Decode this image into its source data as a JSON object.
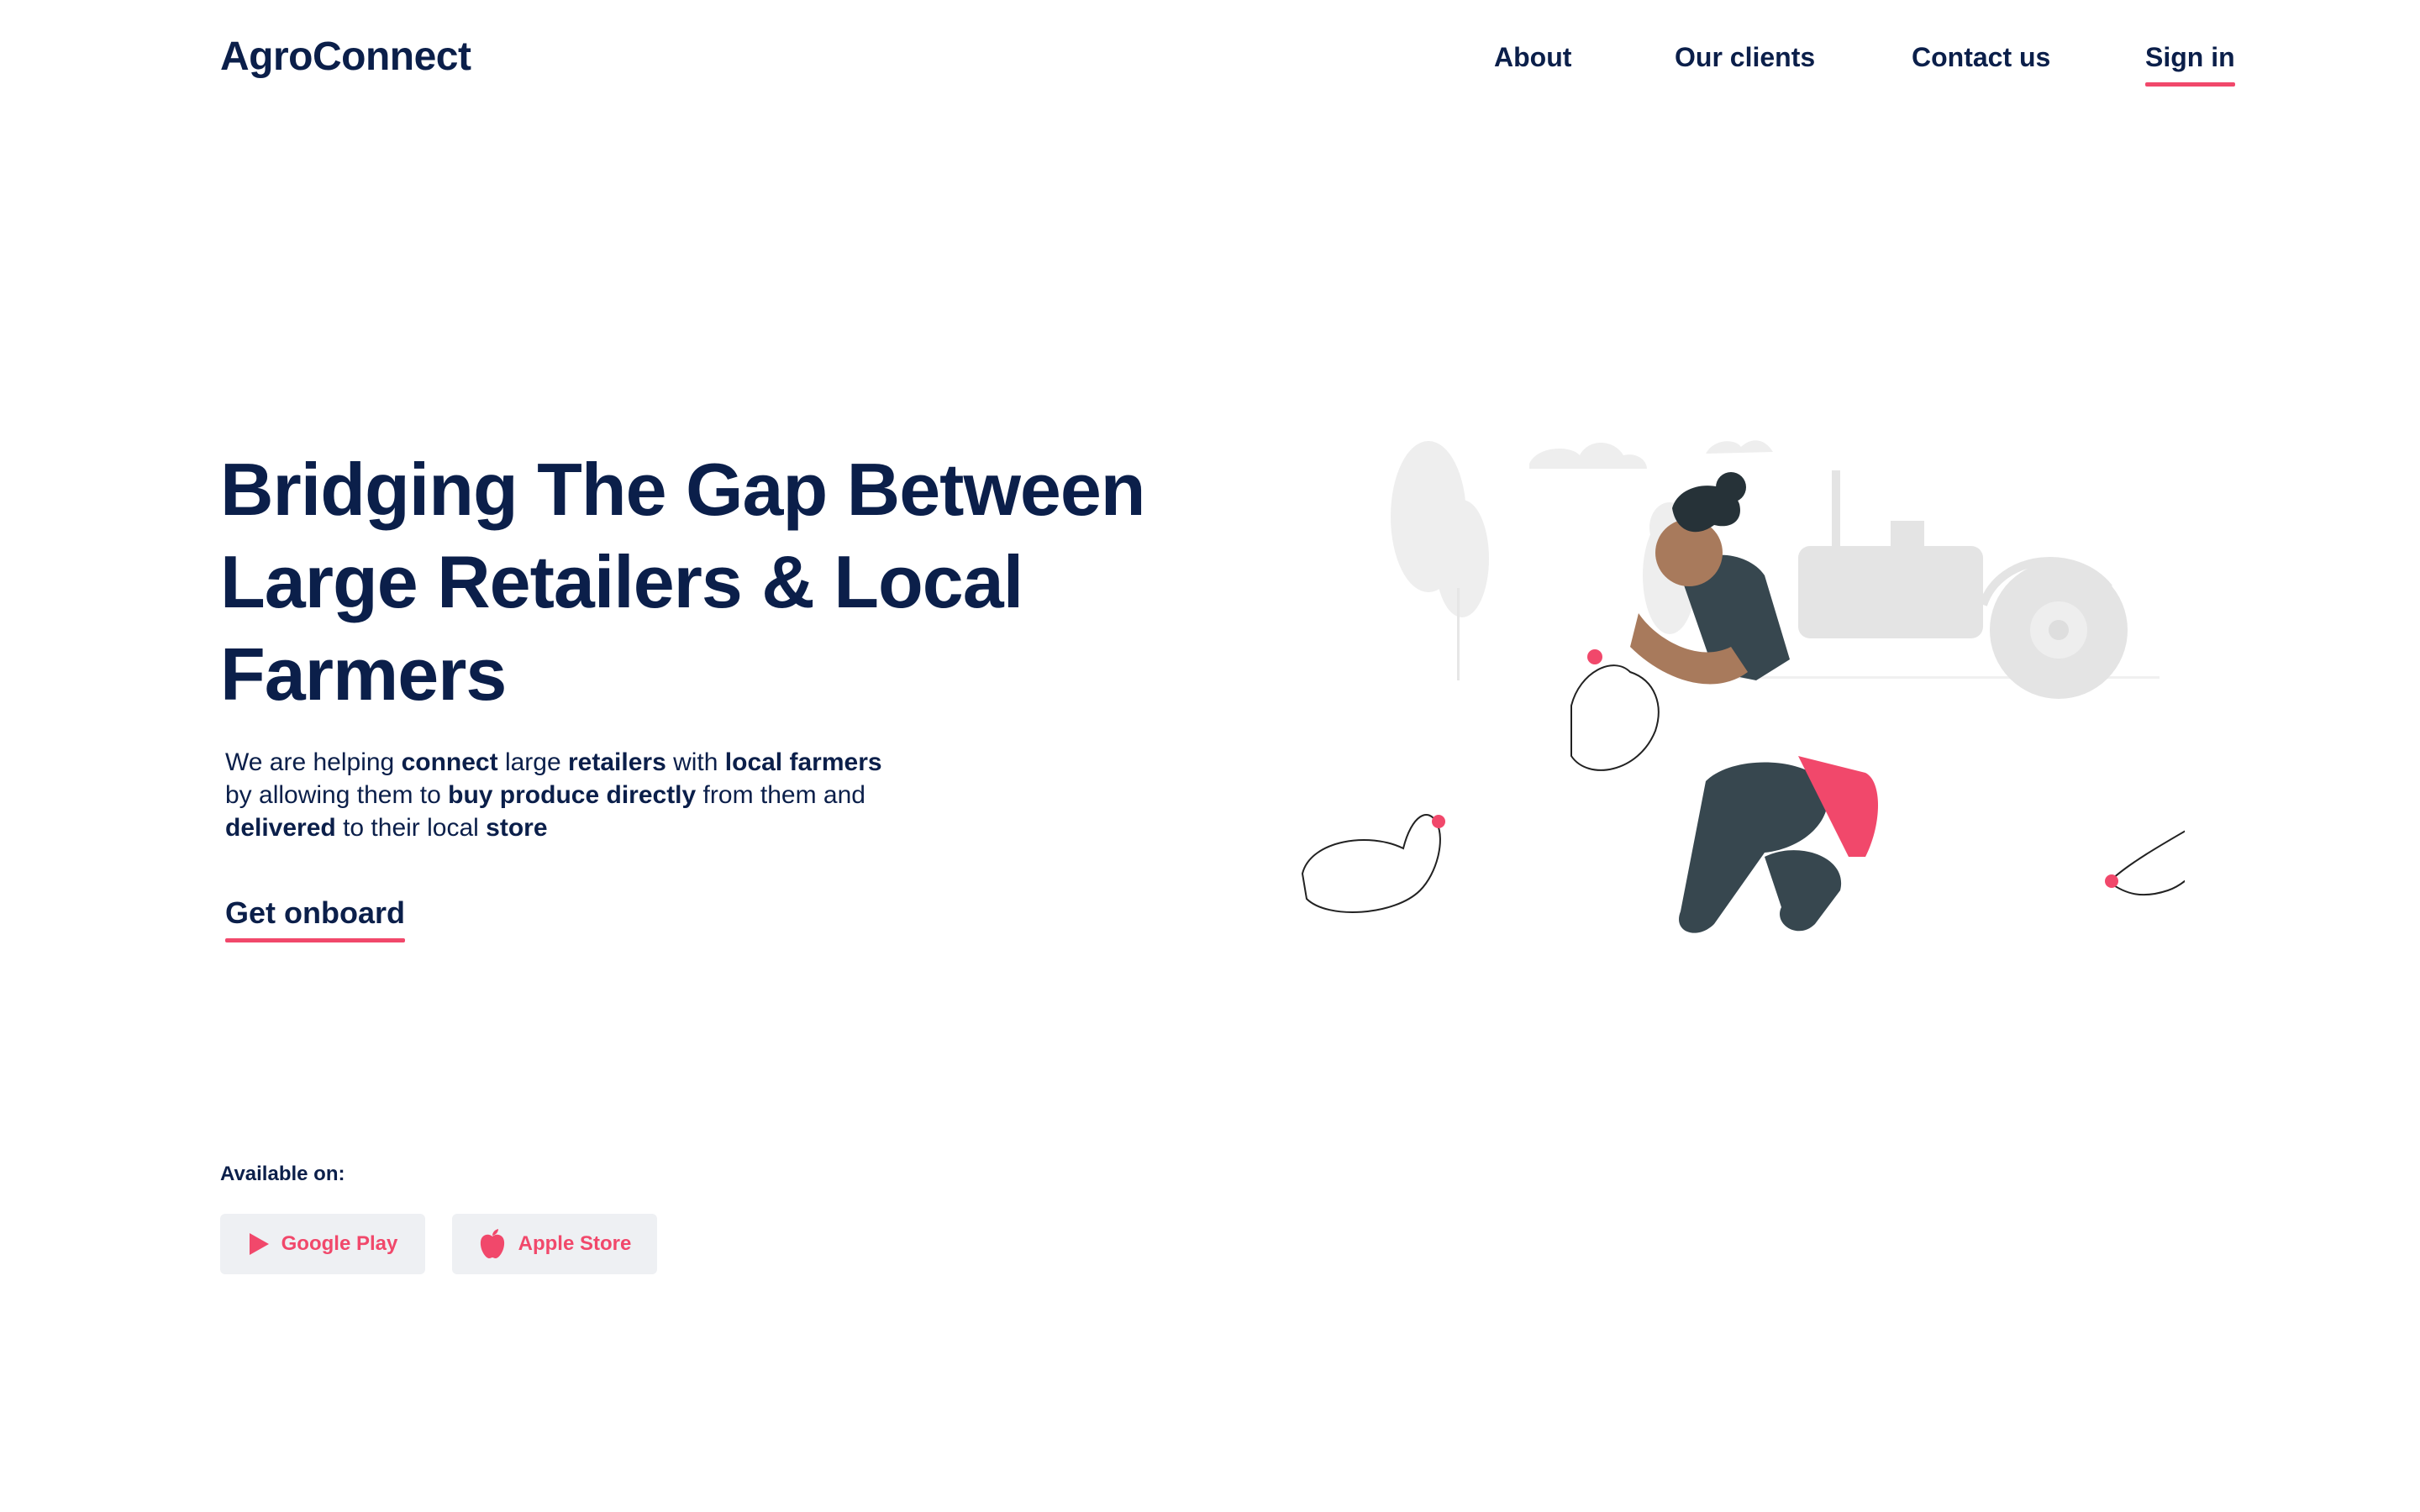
{
  "brand": {
    "name": "AgroConnect"
  },
  "nav": {
    "items": [
      {
        "label": "About"
      },
      {
        "label": "Our clients"
      },
      {
        "label": "Contact us"
      },
      {
        "label": "Sign in"
      }
    ]
  },
  "hero": {
    "title_line1": "Bridging The Gap Between",
    "title_line2": "Large Retailers & Local",
    "title_line3": "Farmers",
    "desc": [
      {
        "text": "We are helping ",
        "bold": false
      },
      {
        "text": "connect",
        "bold": true
      },
      {
        "text": " large ",
        "bold": false
      },
      {
        "text": "retailers",
        "bold": true
      },
      {
        "text": " with ",
        "bold": false
      },
      {
        "text": "local farmers",
        "bold": true
      },
      {
        "text": " by allowing them to ",
        "bold": false
      },
      {
        "text": "buy produce directly",
        "bold": true
      },
      {
        "text": " from them and ",
        "bold": false
      },
      {
        "text": "delivered",
        "bold": true
      },
      {
        "text": " to their local ",
        "bold": false
      },
      {
        "text": "store",
        "bold": true
      }
    ],
    "cta_label": "Get onboard"
  },
  "availability": {
    "label": "Available on:",
    "stores": [
      {
        "label": "Google Play",
        "icon": "play-icon"
      },
      {
        "label": "Apple Store",
        "icon": "apple-icon"
      }
    ]
  },
  "colors": {
    "primary": "#0b1f4a",
    "accent": "#f1486b",
    "store_bg": "#eef0f3"
  }
}
